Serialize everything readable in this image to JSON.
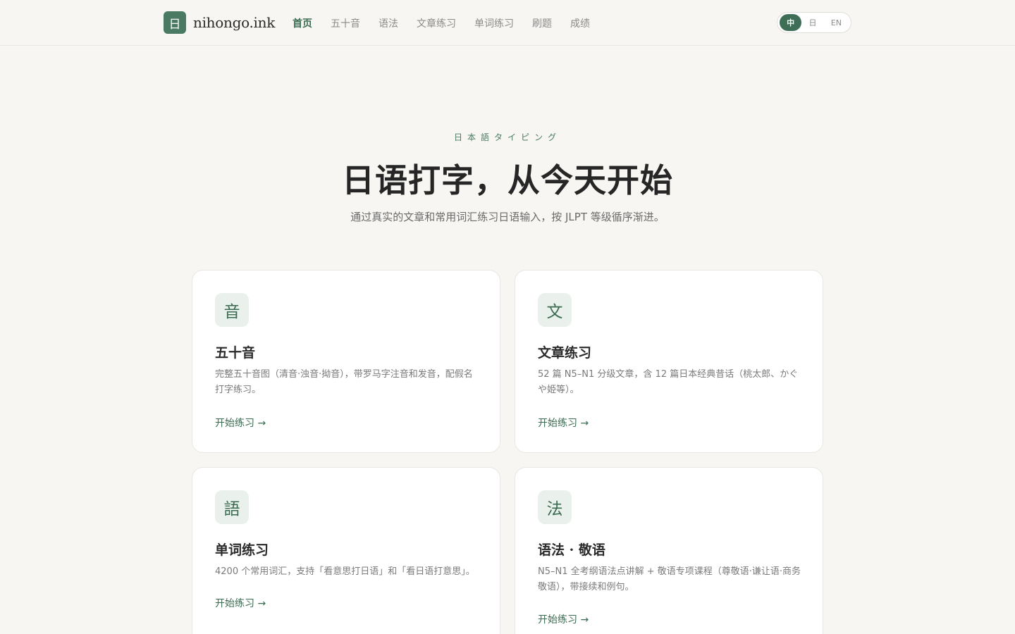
{
  "header": {
    "logo_mark": "日",
    "logo_text": "nihongo.ink",
    "nav": [
      "首页",
      "五十音",
      "语法",
      "文章练习",
      "单词练习",
      "刷题",
      "成绩"
    ],
    "lang": [
      "中",
      "日",
      "EN"
    ]
  },
  "hero": {
    "kicker": "日本語タイピング",
    "title": "日语打字，从今天开始",
    "subtitle": "通过真实的文章和常用词汇练习日语输入，按 JLPT 等级循序渐进。"
  },
  "cards": [
    {
      "icon": "音",
      "title": "五十音",
      "desc": "完整五十音图（清音·浊音·拗音），带罗马字注音和发音，配假名打字练习。",
      "link": "开始练习 →"
    },
    {
      "icon": "文",
      "title": "文章练习",
      "desc": "52 篇 N5–N1 分级文章，含 12 篇日本经典昔话（桃太郎、かぐや姫等）。",
      "link": "开始练习 →"
    },
    {
      "icon": "語",
      "title": "单词练习",
      "desc": "4200 个常用词汇，支持「看意思打日语」和「看日语打意思」。",
      "link": "开始练习 →"
    },
    {
      "icon": "法",
      "title": "语法 · 敬语",
      "desc": "N5–N1 全考纲语法点讲解 + 敬语专项课程（尊敬语·谦让语·商务敬语），带接续和例句。",
      "link": "开始练习 →"
    }
  ],
  "colors": {
    "accent": "#3a6b50",
    "accent_bg": "#eaf1ec",
    "page_bg": "#f7f6f2"
  }
}
